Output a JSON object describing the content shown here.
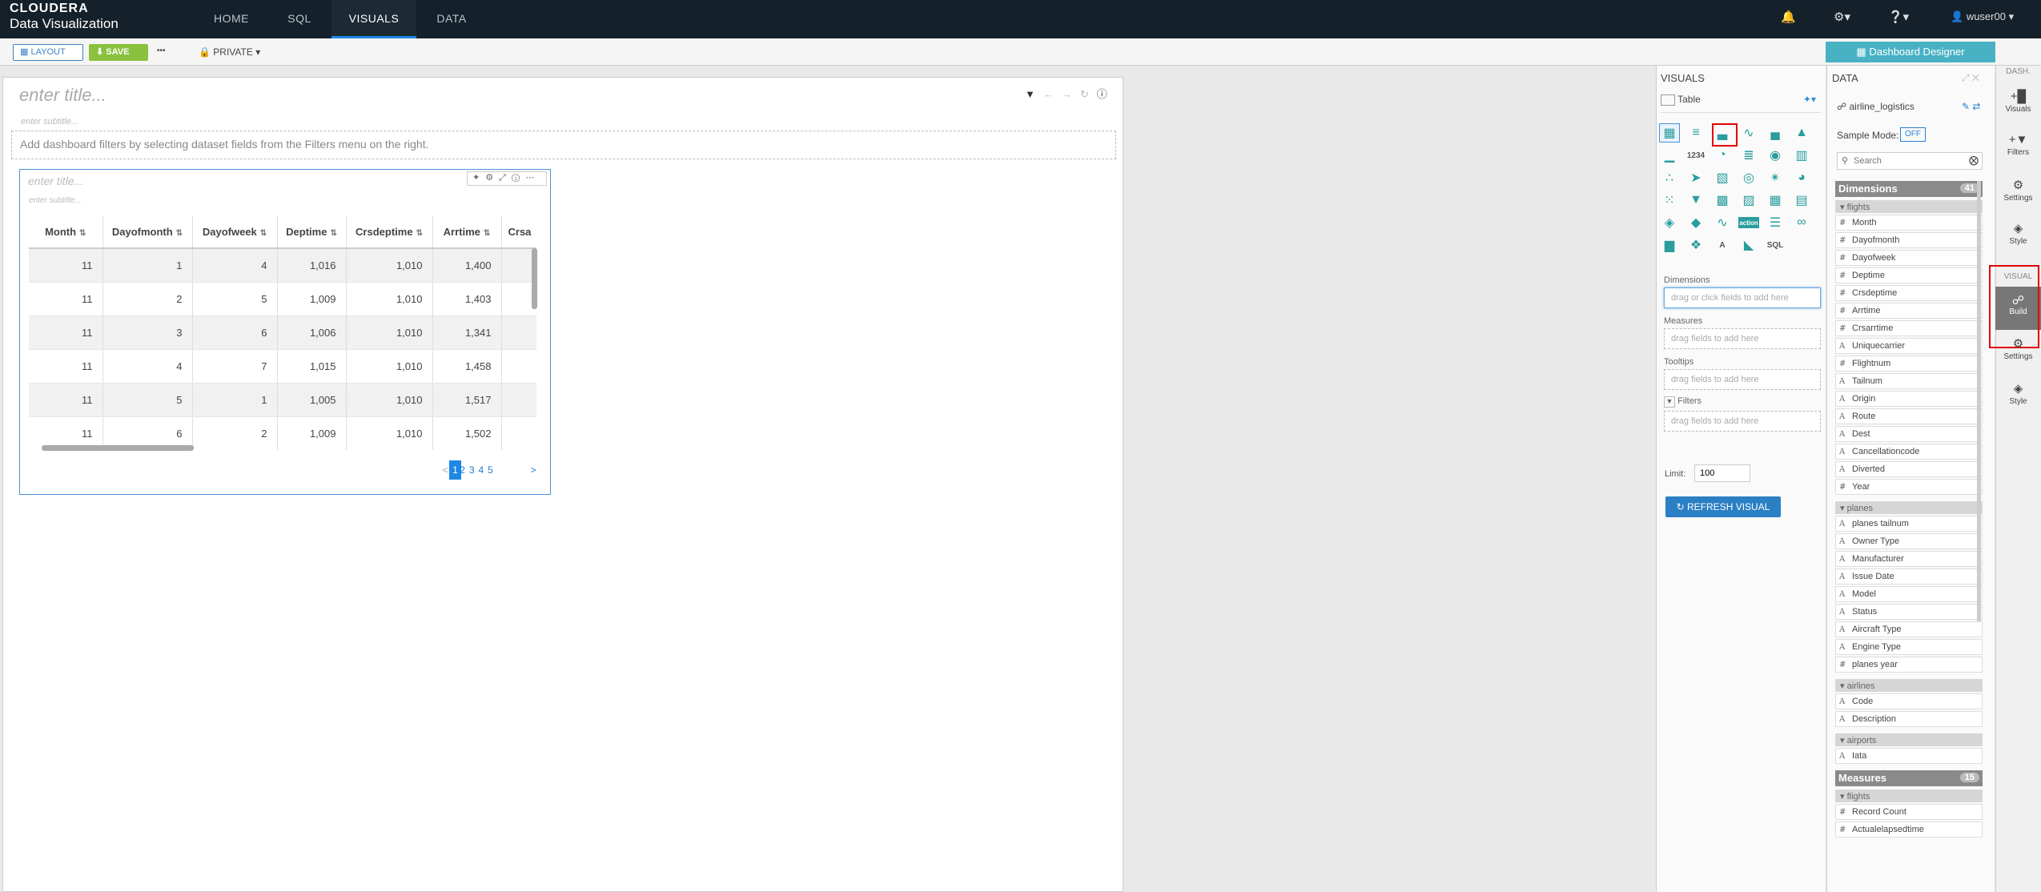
{
  "app": {
    "brand_top": "CLOUDERA",
    "brand_bottom": "Data Visualization"
  },
  "nav": [
    {
      "label": "HOME"
    },
    {
      "label": "SQL"
    },
    {
      "label": "VISUALS"
    },
    {
      "label": "DATA"
    }
  ],
  "header_right": {
    "user": "wuser00"
  },
  "toolbar": {
    "layout": "LAYOUT",
    "save": "SAVE",
    "more": "•••",
    "privacy": "PRIVATE"
  },
  "dashboard": {
    "title_placeholder": "enter title...",
    "subtitle_placeholder": "enter subtitle...",
    "filters_hint": "Add dashboard filters by selecting dataset fields from the Filters menu on the right."
  },
  "visual": {
    "title_placeholder": "enter title...",
    "subtitle_placeholder": "enter subtitle...",
    "columns": [
      "Month",
      "Dayofmonth",
      "Dayofweek",
      "Deptime",
      "Crsdeptime",
      "Arrtime",
      "Crsa"
    ],
    "rows": [
      [
        "11",
        "1",
        "4",
        "1,016",
        "1,010",
        "1,400"
      ],
      [
        "11",
        "2",
        "5",
        "1,009",
        "1,010",
        "1,403"
      ],
      [
        "11",
        "3",
        "6",
        "1,006",
        "1,010",
        "1,341"
      ],
      [
        "11",
        "4",
        "7",
        "1,015",
        "1,010",
        "1,458"
      ],
      [
        "11",
        "5",
        "1",
        "1,005",
        "1,010",
        "1,517"
      ],
      [
        "11",
        "6",
        "2",
        "1,009",
        "1,010",
        "1,502"
      ]
    ],
    "pages": [
      "1",
      "2",
      "3",
      "4",
      "5"
    ],
    "prev": "<",
    "next": ">"
  },
  "designer": {
    "button": "Dashboard Designer"
  },
  "visuals_panel": {
    "title": "VISUALS",
    "selected_type": "Table",
    "shelves": [
      {
        "label": "Dimensions",
        "placeholder": "drag or click fields to add here"
      },
      {
        "label": "Measures",
        "placeholder": "drag fields to add here"
      },
      {
        "label": "Tooltips",
        "placeholder": "drag fields to add here"
      },
      {
        "label": "Filters",
        "placeholder": "drag fields to add here"
      }
    ],
    "limit_label": "Limit:",
    "limit_value": "100",
    "refresh": "REFRESH VISUAL",
    "icon_text": {
      "numeric": "1234",
      "sql": "SQL",
      "action": "action",
      "text": "A"
    }
  },
  "data_panel": {
    "title": "DATA",
    "dataset": "airline_logistics",
    "sample_mode_label": "Sample Mode:",
    "sample_mode_value": "OFF",
    "search_placeholder": "Search",
    "dimensions_label": "Dimensions",
    "dimensions_count": "41",
    "groups": [
      {
        "name": "flights",
        "fields": [
          [
            "#",
            "Month"
          ],
          [
            "#",
            "Dayofmonth"
          ],
          [
            "#",
            "Dayofweek"
          ],
          [
            "#",
            "Deptime"
          ],
          [
            "#",
            "Crsdeptime"
          ],
          [
            "#",
            "Arrtime"
          ],
          [
            "#",
            "Crsarrtime"
          ],
          [
            "A",
            "Uniquecarrier"
          ],
          [
            "#",
            "Flightnum"
          ],
          [
            "A",
            "Tailnum"
          ],
          [
            "A",
            "Origin"
          ],
          [
            "A",
            "Route"
          ],
          [
            "A",
            "Dest"
          ],
          [
            "A",
            "Cancellationcode"
          ],
          [
            "A",
            "Diverted"
          ],
          [
            "#",
            "Year"
          ]
        ]
      },
      {
        "name": "planes",
        "fields": [
          [
            "A",
            "planes tailnum"
          ],
          [
            "A",
            "Owner Type"
          ],
          [
            "A",
            "Manufacturer"
          ],
          [
            "A",
            "Issue Date"
          ],
          [
            "A",
            "Model"
          ],
          [
            "A",
            "Status"
          ],
          [
            "A",
            "Aircraft Type"
          ],
          [
            "A",
            "Engine Type"
          ],
          [
            "#",
            "planes year"
          ]
        ]
      },
      {
        "name": "airlines",
        "fields": [
          [
            "A",
            "Code"
          ],
          [
            "A",
            "Description"
          ]
        ]
      },
      {
        "name": "airports",
        "fields": [
          [
            "A",
            "Iata"
          ]
        ]
      }
    ],
    "measures_label": "Measures",
    "measures_count": "15",
    "measure_groups": [
      {
        "name": "flights",
        "fields": [
          [
            "#",
            "Record Count"
          ],
          [
            "#",
            "Actualelapsedtime"
          ]
        ]
      }
    ]
  },
  "rail": {
    "dash_label": "DASH.",
    "visual_label": "VISUAL",
    "items": [
      {
        "label": "Visuals"
      },
      {
        "label": "Filters"
      },
      {
        "label": "Settings"
      },
      {
        "label": "Style"
      },
      {
        "label": "Build"
      },
      {
        "label": "Settings"
      },
      {
        "label": "Style"
      }
    ]
  }
}
